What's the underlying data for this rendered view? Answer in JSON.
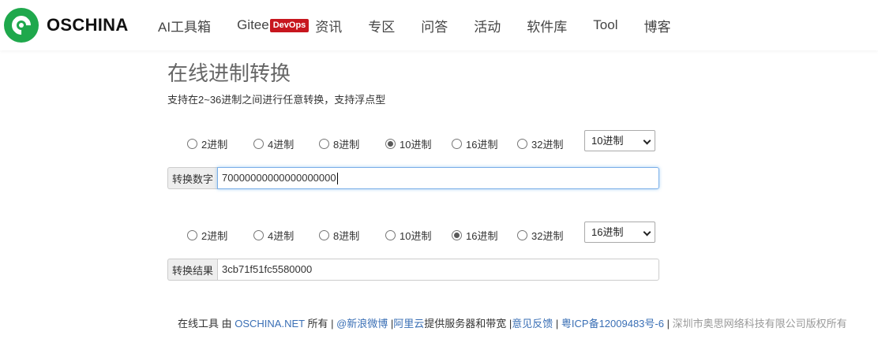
{
  "brand": {
    "name": "OSCHINA",
    "color": "#1fa84c",
    "icon": "oschina-logo-icon"
  },
  "nav": {
    "items": [
      {
        "label": "AI工具箱"
      },
      {
        "label": "Gitee",
        "badge": "DevOps"
      },
      {
        "label": "资讯"
      },
      {
        "label": "专区"
      },
      {
        "label": "问答"
      },
      {
        "label": "活动"
      },
      {
        "label": "软件库"
      },
      {
        "label": "Tool"
      },
      {
        "label": "博客"
      }
    ],
    "badge_color": "#c7161e"
  },
  "page": {
    "title": "在线进制转换",
    "subtitle": "支持在2~36进制之间进行任意转换，支持浮点型"
  },
  "input_section": {
    "radios": [
      {
        "label": "2进制",
        "checked": false
      },
      {
        "label": "4进制",
        "checked": false
      },
      {
        "label": "8进制",
        "checked": false
      },
      {
        "label": "10进制",
        "checked": true
      },
      {
        "label": "16进制",
        "checked": false
      },
      {
        "label": "32进制",
        "checked": false
      }
    ],
    "select_value": "10进制",
    "addon_label": "转换数字",
    "value": "70000000000000000000"
  },
  "output_section": {
    "radios": [
      {
        "label": "2进制",
        "checked": false
      },
      {
        "label": "4进制",
        "checked": false
      },
      {
        "label": "8进制",
        "checked": false
      },
      {
        "label": "10进制",
        "checked": false
      },
      {
        "label": "16进制",
        "checked": true
      },
      {
        "label": "32进制",
        "checked": false
      }
    ],
    "select_value": "16进制",
    "addon_label": "转换结果",
    "value": "3cb71f51fc5580000"
  },
  "footer": {
    "part1": "在线工具 由 ",
    "oschina_link": "OSCHINA.NET",
    "part2": " 所有 | ",
    "weibo_link": "@新浪微博",
    "part3": " |",
    "aliyun_link": "阿里云",
    "part4": "提供服务器和带宽 |",
    "feedback_link": "意见反馈",
    "part5": " | ",
    "icp_link": "粤ICP备12009483号-6",
    "part6": " | ",
    "company": "深圳市奥思网络科技有限公司版权所有"
  }
}
